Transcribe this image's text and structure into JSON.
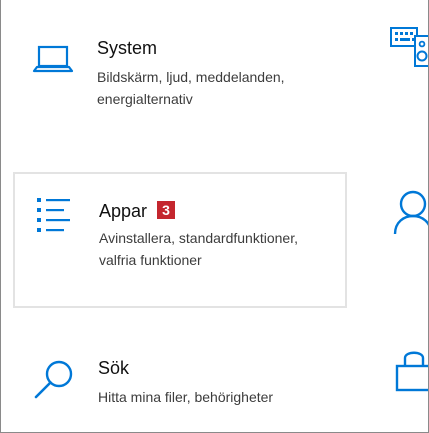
{
  "colors": {
    "accent": "#0078d7",
    "badge": "#c4262e",
    "title_text": "#111111",
    "desc_text": "#3c3c3c",
    "selected_border": "#e3e3e3"
  },
  "tiles": [
    {
      "title": "System",
      "description": "Bildskärm, ljud, meddelanden, energialternativ",
      "icon": "laptop-icon"
    },
    {
      "title": "Appar",
      "badge": "3",
      "description": "Avinstallera, standardfunktioner, valfria funktioner",
      "icon": "apps-list-icon"
    },
    {
      "title": "Sök",
      "description": "Hitta mina filer, behörigheter",
      "icon": "search-icon"
    }
  ],
  "side_icons": [
    "keyboard-icon",
    "person-icon",
    "lock-icon"
  ]
}
